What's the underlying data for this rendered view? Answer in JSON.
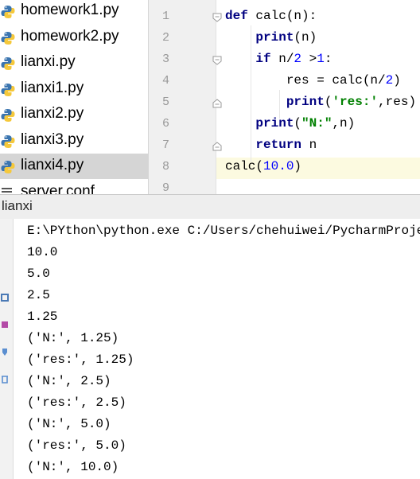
{
  "project_tree": {
    "items": [
      {
        "label": "homework1.py",
        "icon": "python-file-icon",
        "selected": false
      },
      {
        "label": "homework2.py",
        "icon": "python-file-icon",
        "selected": false
      },
      {
        "label": "lianxi.py",
        "icon": "python-file-icon",
        "selected": false
      },
      {
        "label": "lianxi1.py",
        "icon": "python-file-icon",
        "selected": false
      },
      {
        "label": "lianxi2.py",
        "icon": "python-file-icon",
        "selected": false
      },
      {
        "label": "lianxi3.py",
        "icon": "python-file-icon",
        "selected": false
      },
      {
        "label": "lianxi4.py",
        "icon": "python-file-icon",
        "selected": true
      },
      {
        "label": "server.conf",
        "icon": "text-file-icon",
        "selected": false
      }
    ]
  },
  "editor": {
    "line_numbers": [
      "1",
      "2",
      "3",
      "4",
      "5",
      "6",
      "7",
      "8",
      "9"
    ],
    "current_line": "8",
    "code": [
      "def calc(n):",
      "    print(n)",
      "    if n/2 >1:",
      "        res = calc(n/2)",
      "        print('res:',res)",
      "    print(\"N:\",n)",
      "    return n",
      "calc(10.0)",
      ""
    ]
  },
  "run_panel": {
    "title": "lianxi",
    "output": [
      "E:\\PYthon\\python.exe C:/Users/chehuiwei/PycharmProjects",
      "10.0",
      "5.0",
      "2.5",
      "1.25",
      "('N:', 1.25)",
      "('res:', 1.25)",
      "('N:', 2.5)",
      "('res:', 2.5)",
      "('N:', 5.0)",
      "('res:', 5.0)",
      "('N:', 10.0)"
    ],
    "toolbar_icons": [
      "rerun-icon",
      "stop-icon",
      "pin-icon",
      "delete-icon"
    ]
  },
  "colors": {
    "keyword": "#000080",
    "string": "#008000",
    "number": "#0000ff",
    "selection": "#d5d5d5",
    "current_line": "#fcfae0"
  }
}
